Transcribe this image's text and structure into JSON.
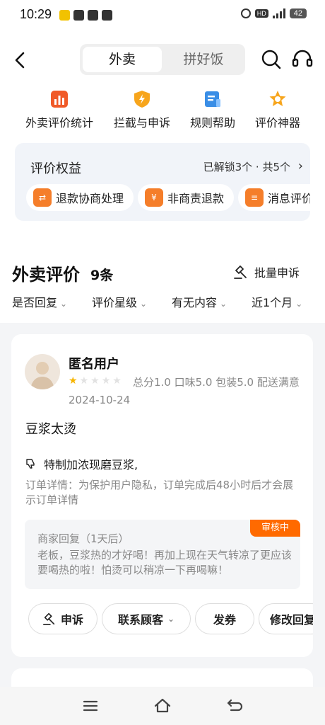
{
  "status_bar": {
    "time": "10:29",
    "hd": "HD",
    "battery": "42"
  },
  "tabs": {
    "active": "外卖",
    "inactive": "拼好饭"
  },
  "tools": [
    {
      "label": "外卖评价统计",
      "icon": "chart-icon",
      "color": "#f05a28"
    },
    {
      "label": "拦截与申诉",
      "icon": "shield-bolt-icon",
      "color": "#f7a51c"
    },
    {
      "label": "规则帮助",
      "icon": "rules-doc-icon",
      "color": "#3a8ee6"
    },
    {
      "label": "评价神器",
      "icon": "star-badge-icon",
      "color": "#f7a51c"
    }
  ],
  "benefits": {
    "title": "评价权益",
    "status": "已解锁3个 · 共5个",
    "chips": [
      {
        "label": "退款协商处理",
        "icon": "refund-icon",
        "color": "#f57e2a"
      },
      {
        "label": "非商责退款",
        "icon": "coupon-icon",
        "color": "#f57e2a"
      },
      {
        "label": "消息评价",
        "icon": "message-icon",
        "color": "#f57e2a"
      }
    ]
  },
  "list": {
    "title": "外卖评价",
    "count": "9条",
    "batch_label": "批量申诉",
    "filters": [
      "是否回复",
      "评价星级",
      "有无内容",
      "近1个月"
    ]
  },
  "review": {
    "user": "匿名用户",
    "stars_filled": 1,
    "stars_total": 5,
    "scores": "总分1.0  口味5.0  包装5.0  配送满意",
    "date": "2024-10-24",
    "content": "豆浆太烫",
    "dislike_item": "特制加浓现磨豆浆,",
    "order_note": "订单详情：为保护用户隐私，订单完成后48小时后才会展示订单详情",
    "reply_head": "商家回复（1天后）",
    "reply_body": "老板，豆浆热的才好喝！再加上现在天气转凉了更应该要喝热的啦！怕烫可以稍凉一下再喝嘛！",
    "reply_badge": "审核中",
    "actions": [
      "申诉",
      "联系顾客",
      "发券",
      "修改回复"
    ]
  },
  "colors": {
    "accent": "#ff6a00",
    "star": "#f7b500"
  }
}
